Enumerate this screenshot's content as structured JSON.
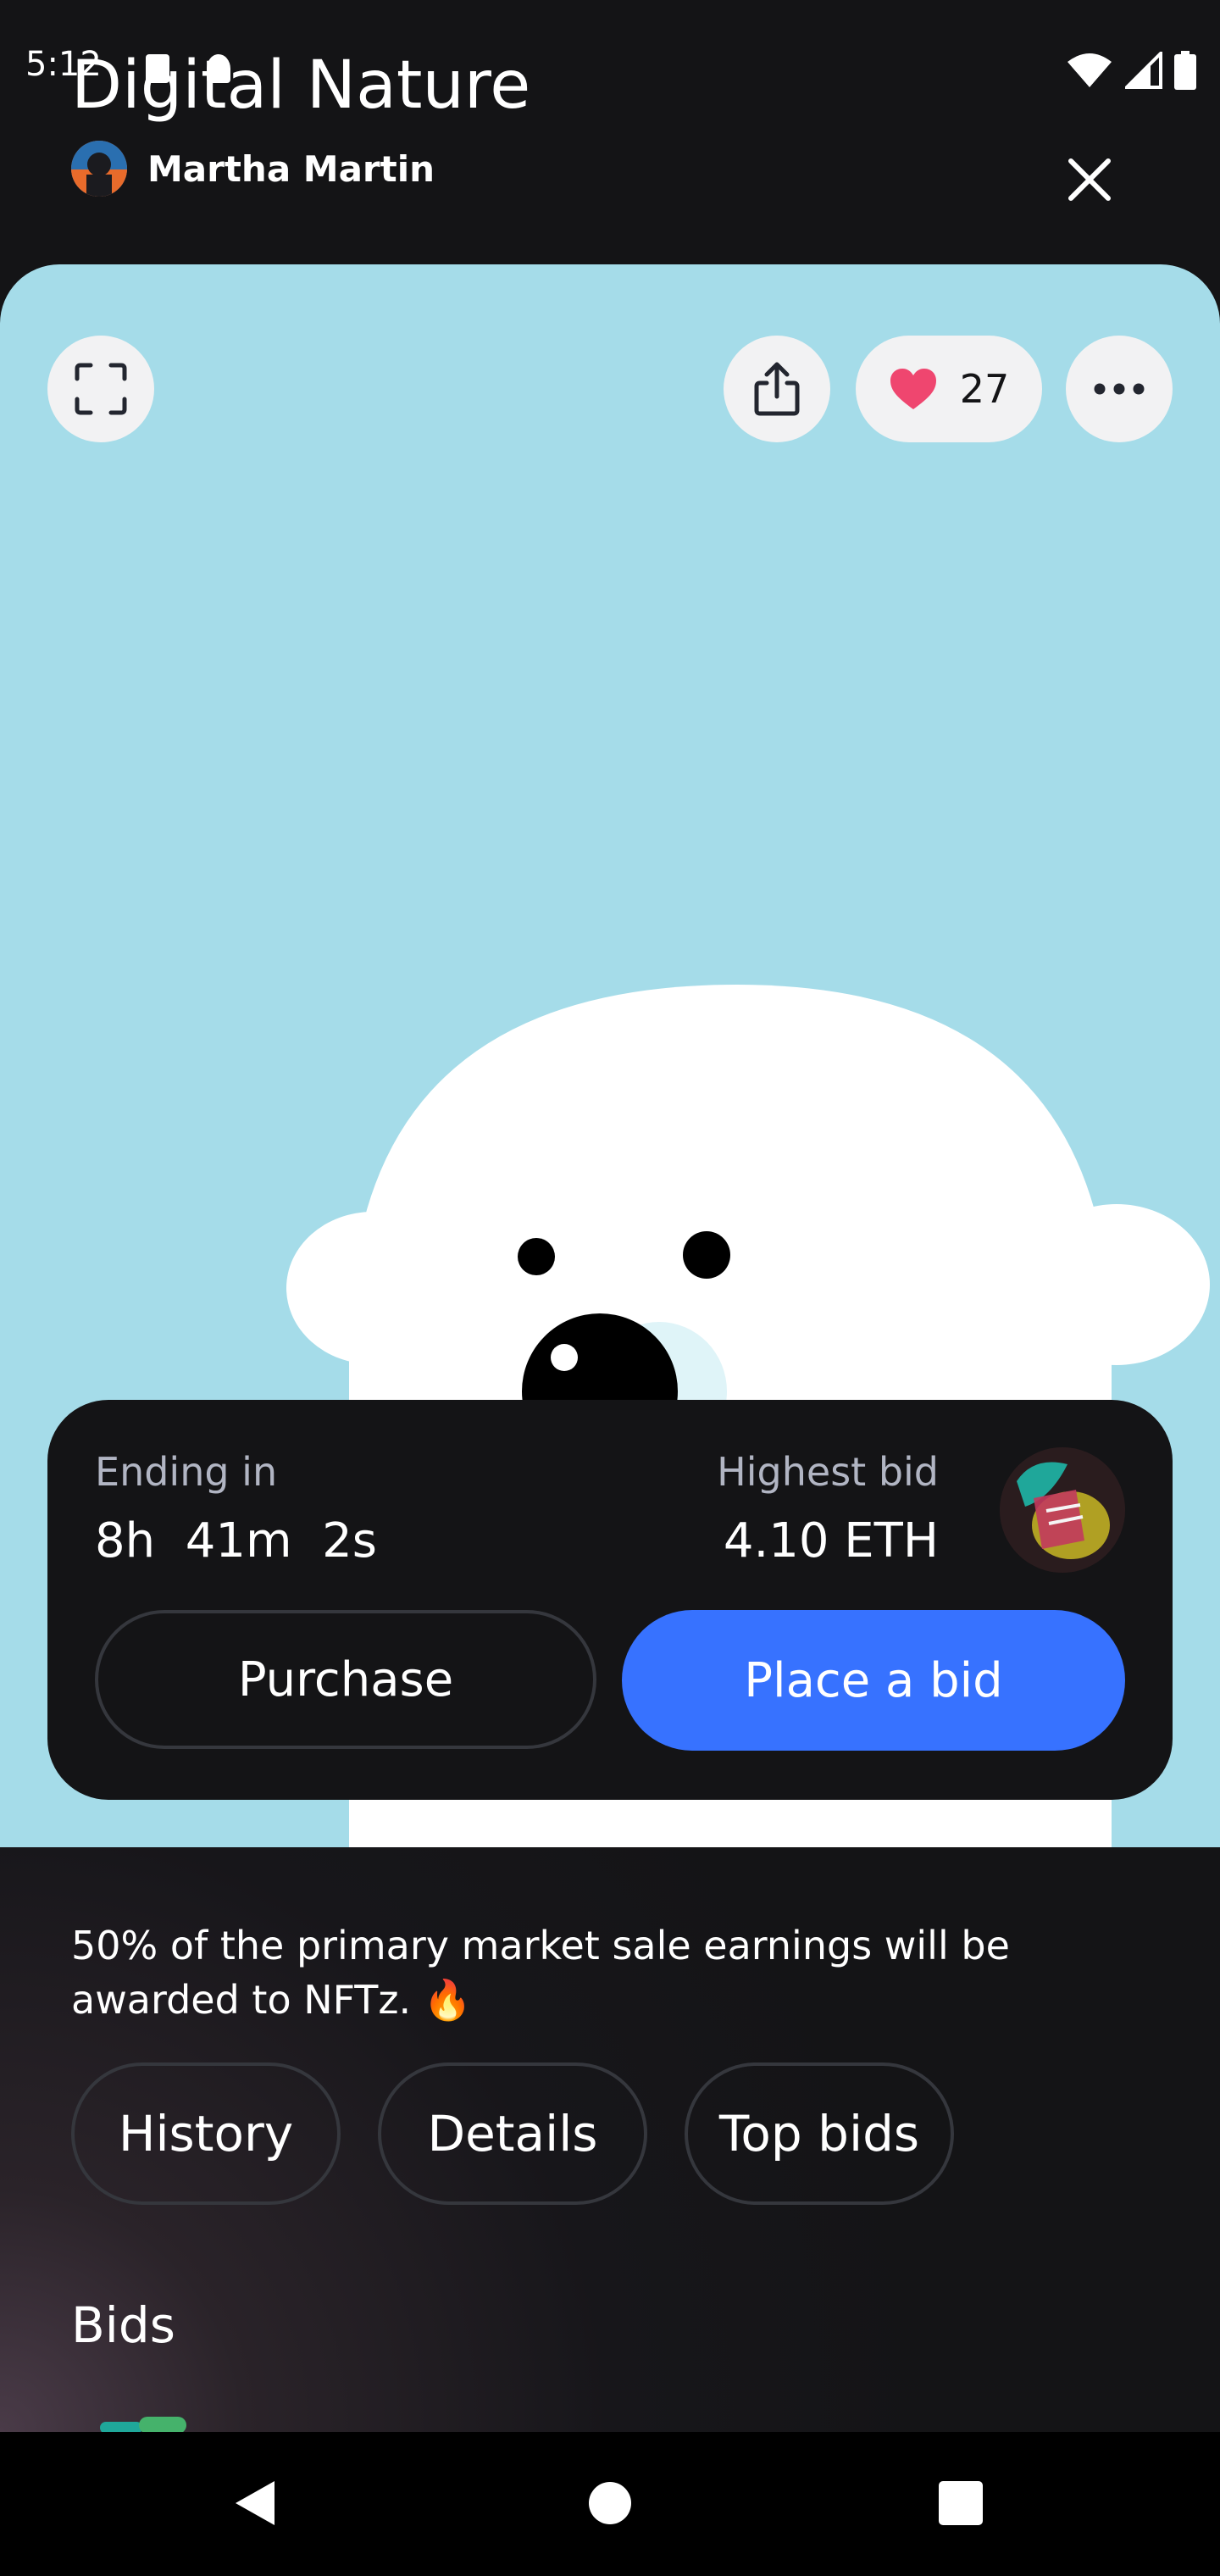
{
  "status_bar": {
    "time": "5:12",
    "icons": [
      "notification-a-icon",
      "notification-dot-icon",
      "wifi-icon",
      "signal-icon",
      "battery-icon"
    ]
  },
  "header": {
    "title": "Digital Nature",
    "author_name": "Martha Martin",
    "close_icon": "close-icon"
  },
  "artwork": {
    "background_color": "#a5dce9",
    "fullscreen_icon": "fullscreen-icon",
    "share_icon": "share-icon",
    "like_icon": "heart-icon",
    "like_count": "27",
    "more_icon": "more-icon"
  },
  "auction": {
    "ending_label": "Ending in",
    "ending_value": "8h  41m  2s",
    "highest_bid_label": "Highest bid",
    "highest_bid_value": "4.10 ETH",
    "purchase_label": "Purchase",
    "bid_label": "Place a bid",
    "accent_color": "#3772ff"
  },
  "info": {
    "description": "50% of the primary market sale earnings will be awarded to NFTz. 🔥",
    "tabs": [
      "History",
      "Details",
      "Top bids"
    ],
    "bids_heading": "Bids"
  },
  "nav": {
    "icons": [
      "back-icon",
      "home-icon",
      "recents-icon"
    ]
  }
}
